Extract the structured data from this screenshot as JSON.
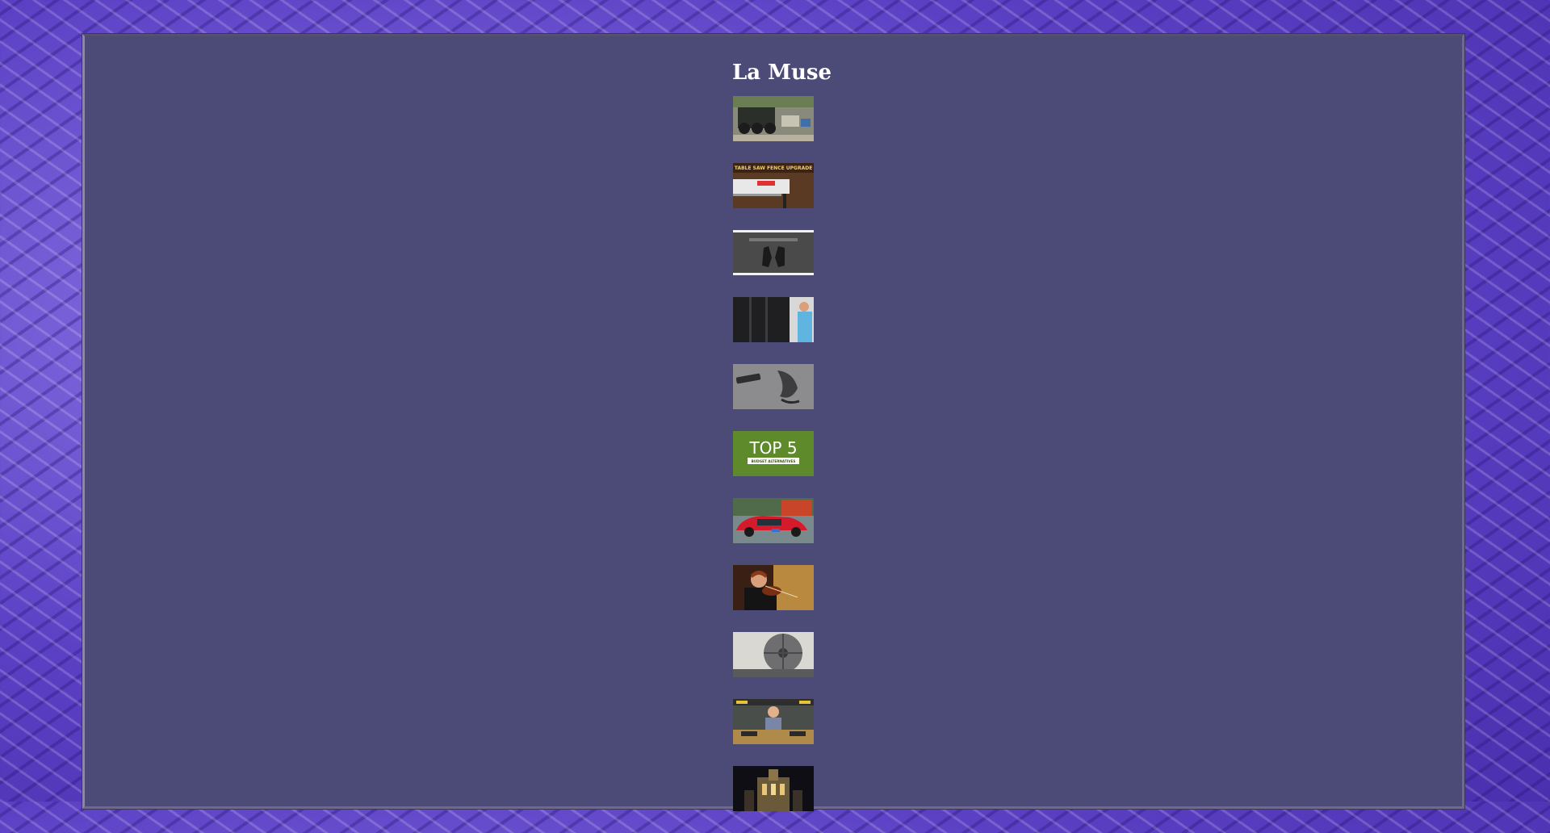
{
  "page": {
    "title": "La Muse"
  },
  "thumbnails": [
    {
      "name": "thumbnail-locomotive-model",
      "alt": ""
    },
    {
      "name": "thumbnail-table-saw-fence-upgrade",
      "caption": "TABLE SAW FENCE UPGRADE"
    },
    {
      "name": "thumbnail-dark-gloves",
      "alt": ""
    },
    {
      "name": "thumbnail-man-at-door",
      "alt": ""
    },
    {
      "name": "thumbnail-gray-tools",
      "alt": ""
    },
    {
      "name": "thumbnail-top5",
      "caption": "TOP 5",
      "subcaption": "BUDGET ALTERNATIVES"
    },
    {
      "name": "thumbnail-red-car",
      "alt": ""
    },
    {
      "name": "thumbnail-violinist",
      "alt": ""
    },
    {
      "name": "thumbnail-saw-blade",
      "alt": ""
    },
    {
      "name": "thumbnail-workshop-man",
      "alt": ""
    },
    {
      "name": "thumbnail-cathedral",
      "alt": ""
    }
  ],
  "colors": {
    "frame_bg": "#4c4a76",
    "title_text": "#ffffff",
    "body_pattern": "#5a3fc0"
  }
}
